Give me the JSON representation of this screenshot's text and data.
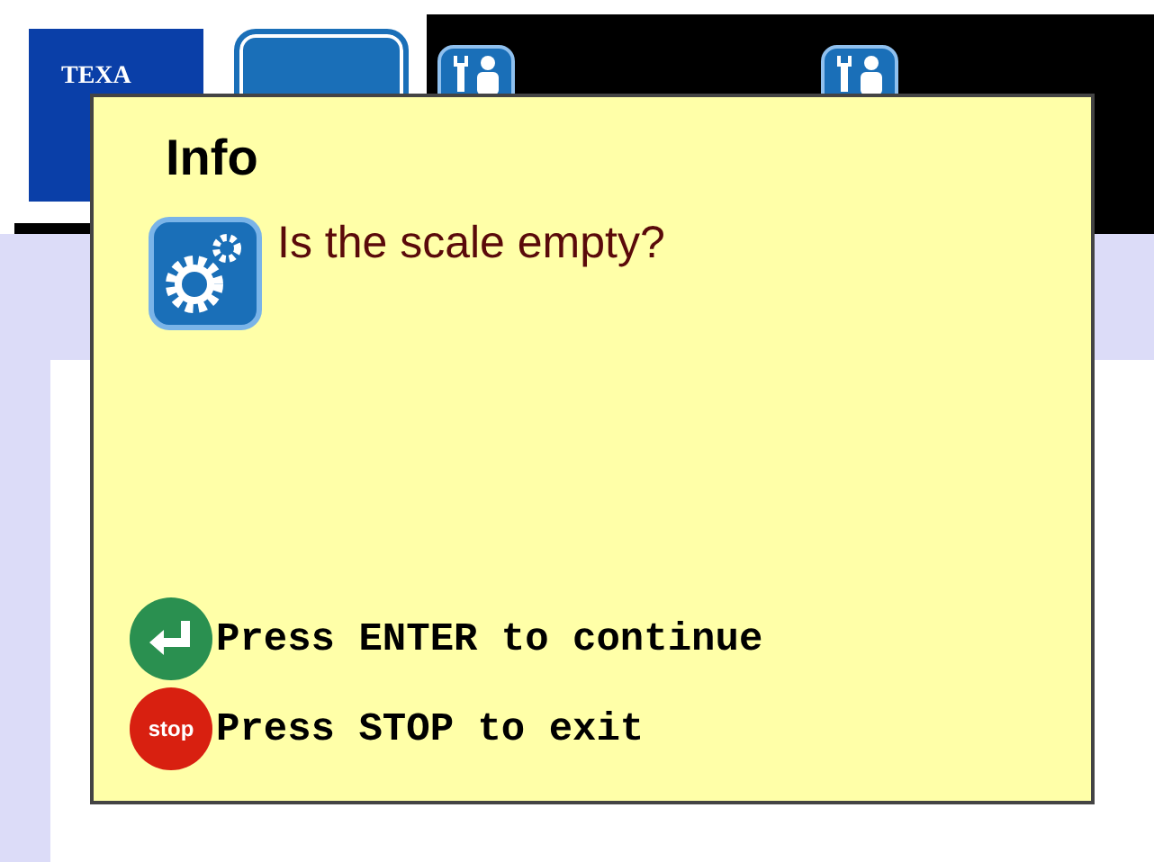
{
  "header": {
    "logo": "TEXA"
  },
  "dialog": {
    "title": "Info",
    "message": "Is the scale empty?",
    "hints": [
      {
        "kind": "enter",
        "text": "Press ENTER to continue"
      },
      {
        "kind": "stop",
        "icon_text": "stop",
        "text": "Press STOP to exit"
      }
    ]
  }
}
